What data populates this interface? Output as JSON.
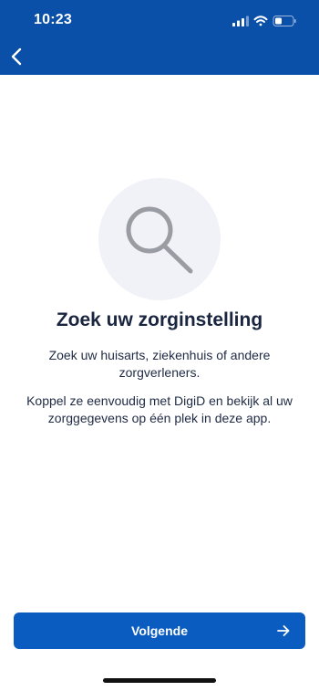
{
  "status_bar": {
    "time": "10:23",
    "icons": [
      "signal-icon",
      "wifi-icon",
      "battery-icon"
    ]
  },
  "header": {
    "back_icon": "chevron-left-icon"
  },
  "main": {
    "illustration_icon": "search-icon",
    "title": "Zoek uw zorginstelling",
    "description_1": "Zoek uw huisarts, ziekenhuis of andere zorgverleners.",
    "description_2": "Koppel ze eenvoudig met DigiD en bekijk al uw zorggegevens op één plek in deze app."
  },
  "footer": {
    "next_button_label": "Volgende",
    "next_icon": "arrow-right-icon"
  },
  "colors": {
    "header": "#0a4fa8",
    "button": "#0b5cc0",
    "illustration_bg": "#f0f2f7",
    "text": "#1a2540"
  }
}
